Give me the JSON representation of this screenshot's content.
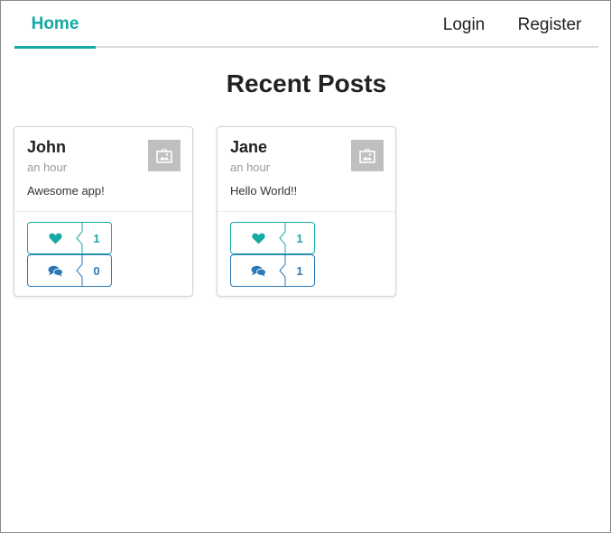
{
  "nav": {
    "home": "Home",
    "login": "Login",
    "register": "Register"
  },
  "page": {
    "title": "Recent Posts"
  },
  "posts": [
    {
      "author": "John",
      "time": "an hour",
      "text": "Awesome app!",
      "likes": "1",
      "comments": "0"
    },
    {
      "author": "Jane",
      "time": "an hour",
      "text": "Hello World!!",
      "likes": "1",
      "comments": "1"
    }
  ],
  "colors": {
    "accent": "#16a9a5",
    "comment": "#2b79b8",
    "thumb": "#bfbfbf"
  },
  "icons": {
    "like": "heart-icon",
    "comment": "comments-icon",
    "thumbnail": "image-icon"
  }
}
